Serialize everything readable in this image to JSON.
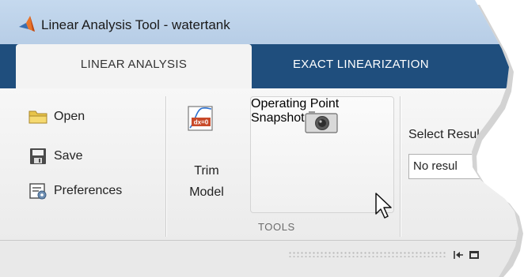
{
  "window": {
    "title": "Linear Analysis Tool - watertank"
  },
  "tabs": [
    {
      "label": "LINEAR ANALYSIS",
      "active": true
    },
    {
      "label": "EXACT LINEARIZATION",
      "active": false
    }
  ],
  "file_group": {
    "items": [
      {
        "label": "Open",
        "icon": "folder-icon"
      },
      {
        "label": "Save",
        "icon": "save-icon"
      },
      {
        "label": "Preferences",
        "icon": "preferences-icon"
      }
    ]
  },
  "tools_group": {
    "label": "TOOLS",
    "trim": {
      "line1": "Trim",
      "line2": "Model",
      "icon": "trim-model-icon"
    },
    "snapshot": {
      "line1": "Operating Point",
      "line2": "Snapshot",
      "icon": "camera-icon"
    }
  },
  "result": {
    "label": "Select Resul",
    "value": "No resul"
  },
  "colors": {
    "titlebar": "#c5d9ee",
    "tabstrip": "#1f4e7d",
    "ribbon": "#f3f3f3"
  }
}
